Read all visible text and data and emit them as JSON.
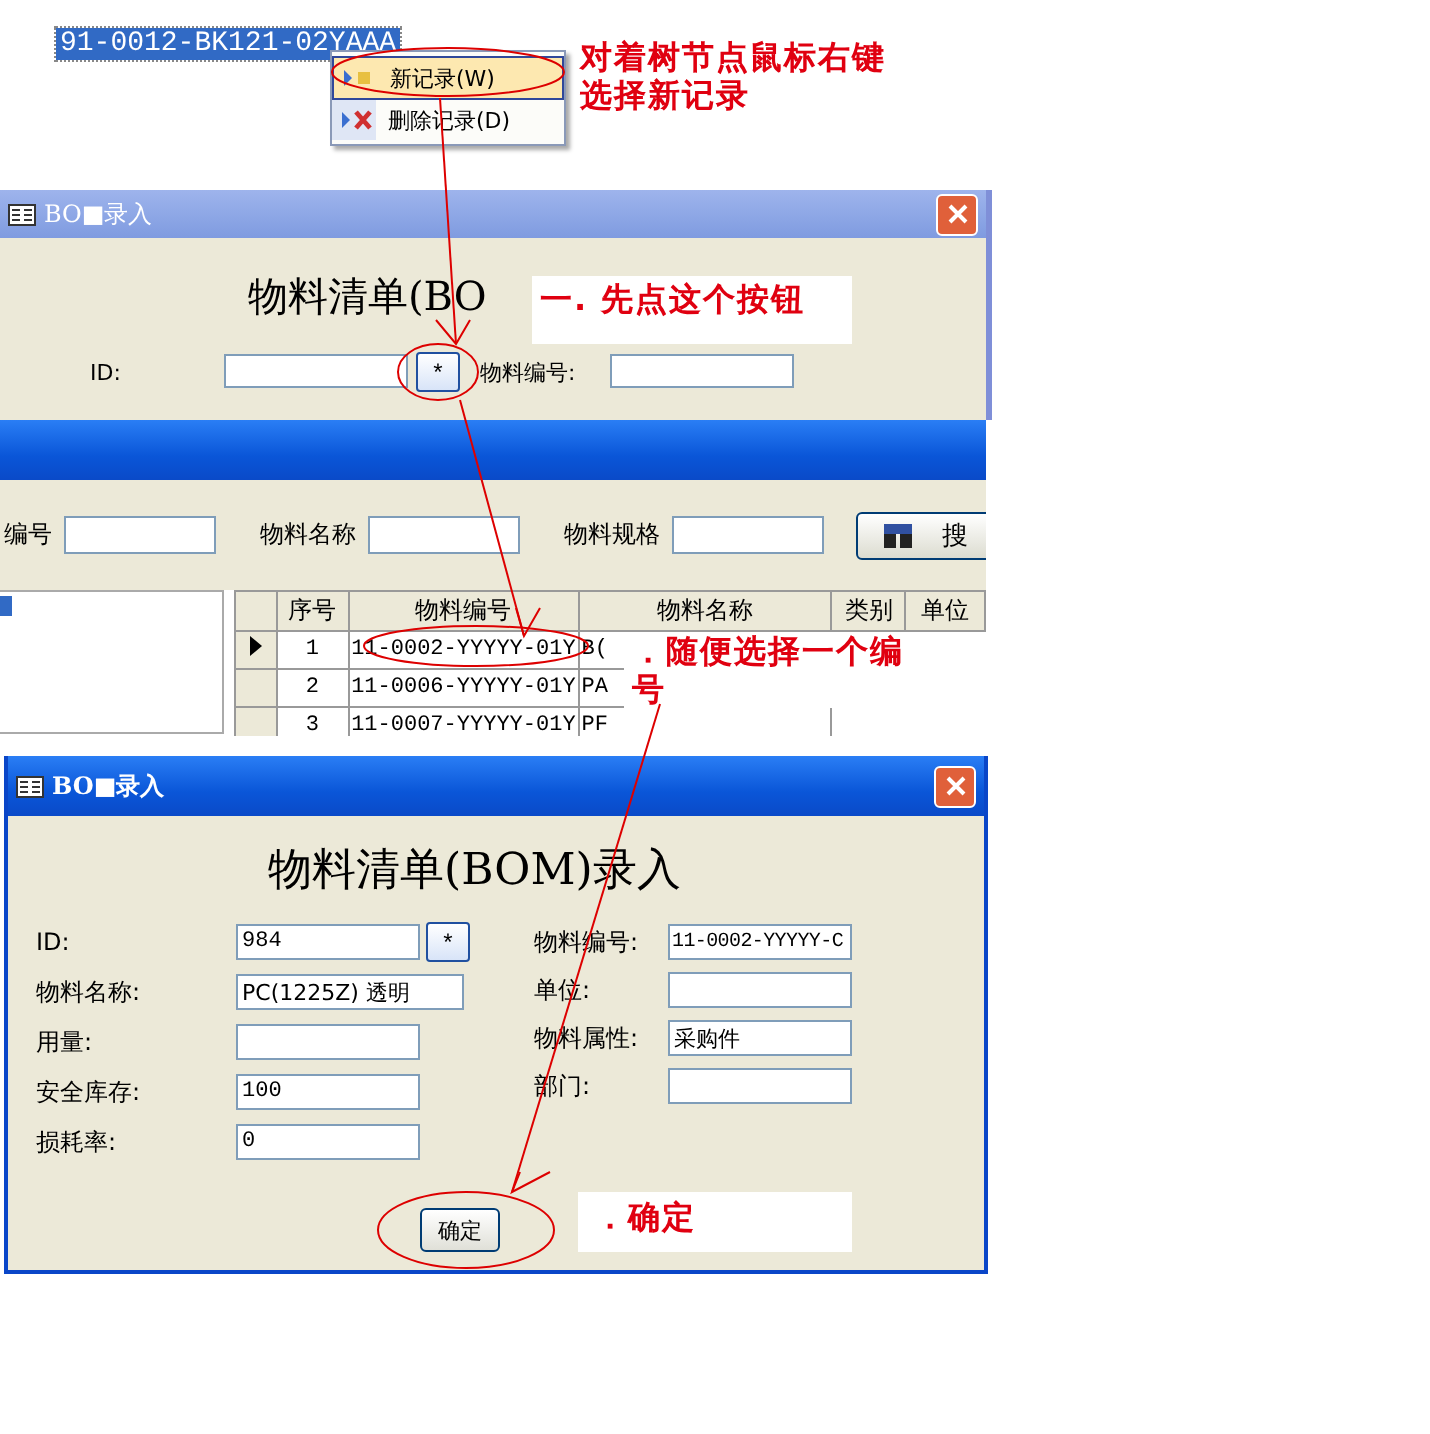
{
  "tree": {
    "nodes": [
      {
        "label": "91-0012-BK121-02YAAA",
        "selected": true
      }
    ]
  },
  "context_menu": {
    "items": [
      {
        "kind": "new",
        "label": "新记录(W)",
        "selected": true
      },
      {
        "kind": "delete",
        "label": "删除记录(D)",
        "selected": false
      }
    ]
  },
  "step_notes": [
    {
      "lines": [
        "对着树节点鼠标右键",
        "选择新记录"
      ]
    },
    {
      "lines": [
        "一. 先点这个按钮"
      ]
    },
    {
      "lines": [
        "．随便选择一个编",
        "号"
      ]
    },
    {
      "lines": [
        "．确定"
      ]
    }
  ],
  "first_dialog": {
    "title": "BO■录入",
    "heading": "物料清单(BO",
    "id_label": "ID:",
    "pick_button": "*",
    "code_label": "物料编号:"
  },
  "picker": {
    "filters": [
      {
        "label": "编号"
      },
      {
        "label": "物料名称"
      },
      {
        "label": "物料规格"
      }
    ],
    "search_button": "搜",
    "table": {
      "columns": [
        "序号",
        "物料编号",
        "物料名称",
        "类别",
        "单位"
      ],
      "rows": [
        {
          "selected": true,
          "cells": [
            "1",
            "11-0002-YYYYY-01Y",
            "B("
          ]
        },
        {
          "selected": false,
          "cells": [
            "2",
            "11-0006-YYYYY-01Y",
            "PA"
          ]
        },
        {
          "selected": false,
          "cells": [
            "3",
            "11-0007-YYYYY-01Y",
            "PF"
          ]
        }
      ]
    }
  },
  "second_dialog": {
    "title": "BO■录入",
    "heading": "物料清单(BOM)录入",
    "pick_button": "*",
    "left_fields": [
      {
        "label": "ID:",
        "value": "984"
      },
      {
        "label": "物料名称:",
        "value": "PC(1225Z) 透明"
      },
      {
        "label": "用量:"
      },
      {
        "label": "安全库存:",
        "value": "100"
      },
      {
        "label": "损耗率:",
        "value": "0"
      }
    ],
    "right_fields": [
      {
        "label": "物料编号:",
        "value": "11-0002-YYYYY-C"
      },
      {
        "label": "单位:"
      },
      {
        "label": "物料属性:",
        "value": "采购件"
      },
      {
        "label": "部门:"
      }
    ],
    "ok_button": "确定"
  }
}
